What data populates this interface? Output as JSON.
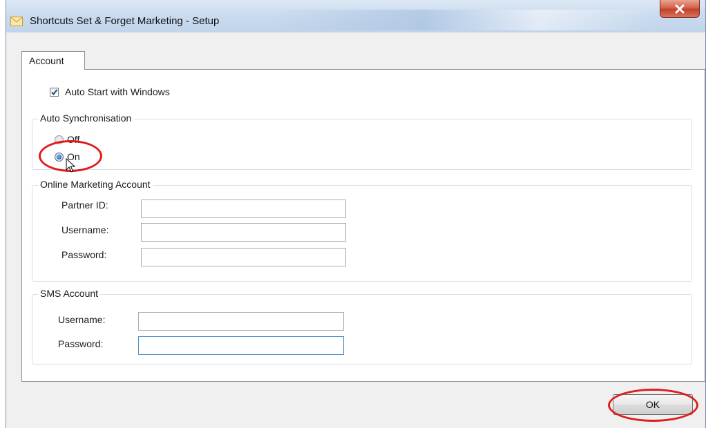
{
  "window": {
    "title": "Shortcuts Set & Forget Marketing - Setup",
    "close_glyph": "X"
  },
  "tabs": [
    {
      "label": "Account",
      "selected": true
    }
  ],
  "auto_start": {
    "label": "Auto Start with Windows",
    "checked": true
  },
  "auto_sync": {
    "group_label": "Auto Synchronisation",
    "options": [
      {
        "label": "Off",
        "selected": false
      },
      {
        "label": "On",
        "selected": true
      }
    ]
  },
  "online_account": {
    "group_label": "Online Marketing Account",
    "fields": [
      {
        "label": "Partner ID:",
        "value": ""
      },
      {
        "label": "Username:",
        "value": ""
      },
      {
        "label": "Password:",
        "value": ""
      }
    ]
  },
  "sms_account": {
    "group_label": "SMS Account",
    "fields": [
      {
        "label": "Username:",
        "value": ""
      },
      {
        "label": "Password:",
        "value": ""
      }
    ]
  },
  "ok_button": {
    "label": "OK"
  },
  "colors": {
    "annotation": "#e01b1b",
    "accent": "#1a4f94"
  },
  "icons": {
    "app": "envelope-icon",
    "close": "close-icon",
    "check": "checkmark-icon",
    "cursor": "mouse-pointer-icon"
  }
}
